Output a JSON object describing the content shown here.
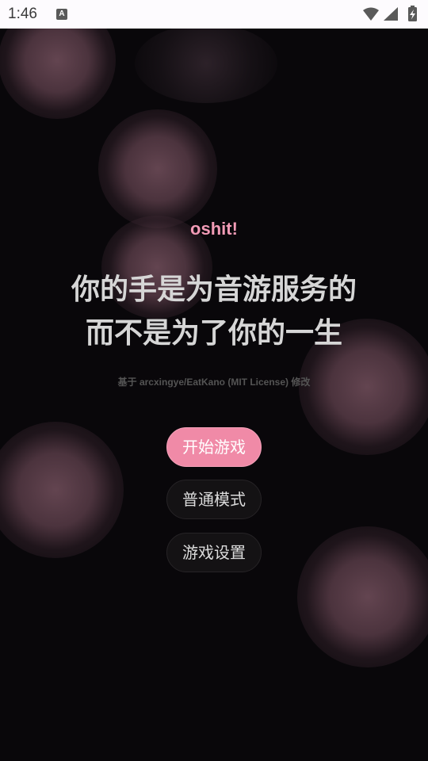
{
  "status_bar": {
    "time": "1:46",
    "notification_icon_label": "A",
    "icons": [
      "wifi-icon",
      "cell-signal-icon",
      "battery-charging-icon"
    ]
  },
  "app": {
    "title": "oshit!",
    "tagline_line1": "你的手是为音游服务的",
    "tagline_line2": "而不是为了你的一生",
    "credit": "基于 arcxingye/EatKano (MIT License) 修改"
  },
  "menu": {
    "start_label": "开始游戏",
    "normal_mode_label": "普通模式",
    "settings_label": "游戏设置"
  },
  "colors": {
    "accent": "#f08aa7",
    "title_pink": "#f29bb6",
    "background": "#09070a",
    "blob": "#684854",
    "secondary_button": "#141214"
  }
}
